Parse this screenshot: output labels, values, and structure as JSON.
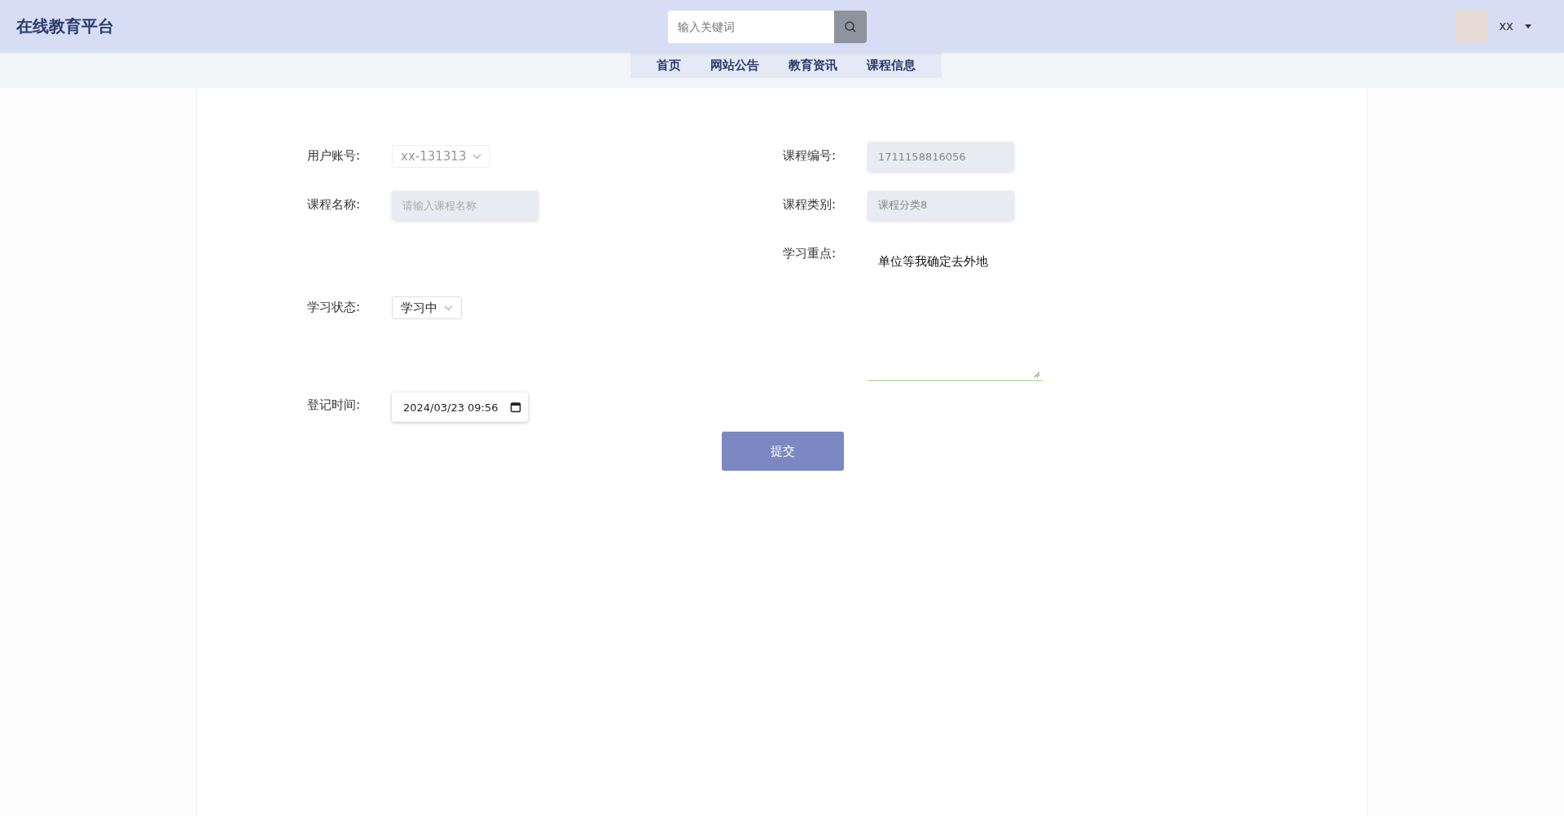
{
  "header": {
    "title": "在线教育平台",
    "search": {
      "placeholder": "输入关键词"
    },
    "user": {
      "name": "xx"
    }
  },
  "nav": [
    {
      "label": "首页"
    },
    {
      "label": "网站公告"
    },
    {
      "label": "教育资讯"
    },
    {
      "label": "课程信息"
    }
  ],
  "form": {
    "left": [
      {
        "kind": "select",
        "label": "用户账号:",
        "value": "xx-131313",
        "disabled": true
      },
      {
        "kind": "input",
        "label": "课程名称:",
        "placeholder": "请输入课程名称"
      },
      {
        "kind": "select",
        "label": "学习状态:",
        "value": "学习中",
        "disabled": false
      },
      {
        "kind": "date",
        "label": "登记时间:",
        "value": "2024/03/23 09:56"
      }
    ],
    "right": [
      {
        "kind": "input",
        "label": "课程编号:",
        "value": "1711158816056",
        "disabled": true
      },
      {
        "kind": "input",
        "label": "课程类别:",
        "value": "课程分类8",
        "disabled": true
      },
      {
        "kind": "textarea",
        "label": "学习重点:",
        "value": "单位等我确定去外地"
      }
    ],
    "submit": "提交"
  }
}
